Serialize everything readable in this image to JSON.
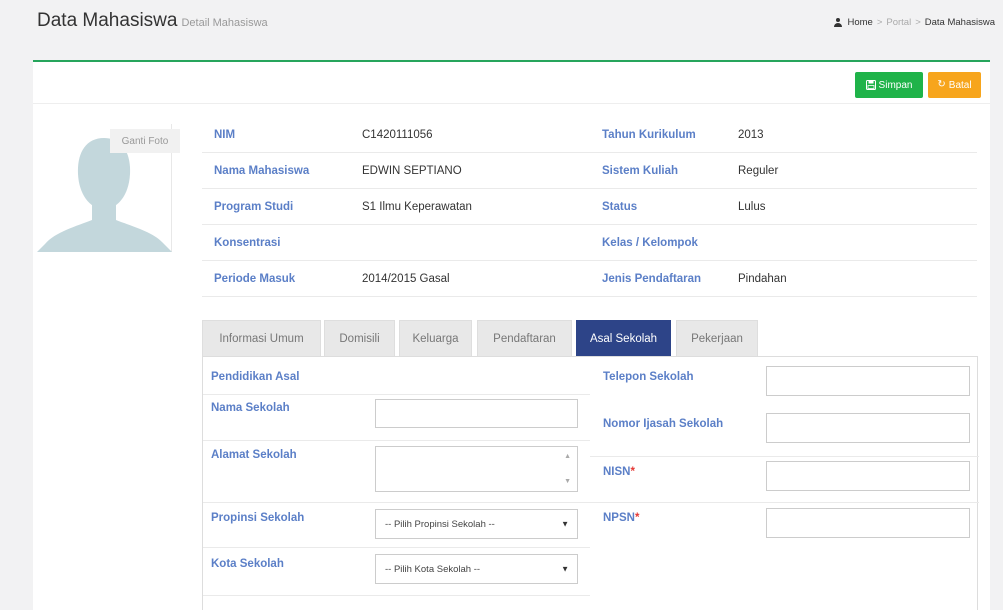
{
  "header": {
    "title": "Data Mahasiswa",
    "subtitle": "Detail Mahasiswa",
    "breadcrumb": {
      "home": "Home",
      "sep": ">",
      "portal": "Portal",
      "current": "Data Mahasiswa"
    }
  },
  "toolbar": {
    "save_label": "Simpan",
    "cancel_label": "Batal"
  },
  "photo": {
    "change_label": "Ganti Foto"
  },
  "info": {
    "rows": [
      {
        "l1": "NIM",
        "v1": "C1420111056",
        "l2": "Tahun Kurikulum",
        "v2": "2013"
      },
      {
        "l1": "Nama Mahasiswa",
        "v1": "EDWIN SEPTIANO",
        "l2": "Sistem Kuliah",
        "v2": "Reguler"
      },
      {
        "l1": "Program Studi",
        "v1": "S1 Ilmu Keperawatan",
        "l2": "Status",
        "v2": "Lulus"
      },
      {
        "l1": "Konsentrasi",
        "v1": "",
        "l2": "Kelas / Kelompok",
        "v2": ""
      },
      {
        "l1": "Periode Masuk",
        "v1": "2014/2015 Gasal",
        "l2": "Jenis Pendaftaran",
        "v2": "Pindahan"
      }
    ]
  },
  "tabs": [
    "Informasi Umum",
    "Domisili",
    "Keluarga",
    "Pendaftaran",
    "Asal Sekolah",
    "Pekerjaan"
  ],
  "active_tab": "Asal Sekolah",
  "form": {
    "pendidikan_asal": "Pendidikan Asal",
    "nama_sekolah": "Nama Sekolah",
    "alamat_sekolah": "Alamat Sekolah",
    "propinsi_sekolah": "Propinsi Sekolah",
    "propinsi_placeholder": "-- Pilih Propinsi Sekolah --",
    "kota_sekolah": "Kota Sekolah",
    "kota_placeholder": "-- Pilih Kota Sekolah --",
    "telepon_sekolah": "Telepon Sekolah",
    "nomor_ijasah": "Nomor Ijasah Sekolah",
    "nisn": "NISN",
    "npsn": "NPSN",
    "required_mark": "*"
  },
  "colors": {
    "accent": "#26a55c",
    "save": "#1fb349",
    "cancel": "#f7a51c",
    "tab_active": "#2d4488",
    "label": "#5b7fc7"
  }
}
